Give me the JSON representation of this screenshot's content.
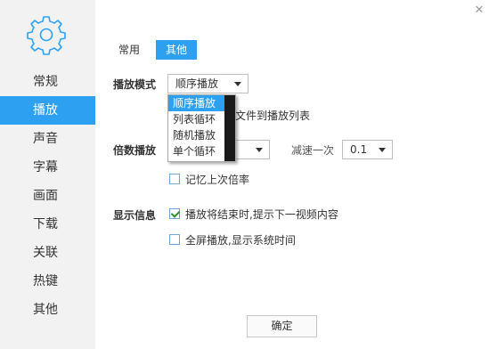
{
  "sidebar": {
    "icon": "gear-icon",
    "items": [
      {
        "label": "常规"
      },
      {
        "label": "播放"
      },
      {
        "label": "声音"
      },
      {
        "label": "字幕"
      },
      {
        "label": "画面"
      },
      {
        "label": "下载"
      },
      {
        "label": "关联"
      },
      {
        "label": "热键"
      },
      {
        "label": "其他"
      }
    ],
    "active_index": 1
  },
  "tabs": [
    {
      "label": "常用"
    },
    {
      "label": "其他"
    }
  ],
  "playback_mode": {
    "label": "播放模式",
    "selected": "顺序播放",
    "options": [
      "顺序播放",
      "列表循环",
      "随机播放",
      "单个循环"
    ],
    "partial_text": "文件到播放列表"
  },
  "speed": {
    "label": "倍数播放",
    "decrease_label": "减速一次",
    "decrease_value": "0.1",
    "remember_label": "记忆上次倍率",
    "remember_checked": false
  },
  "display_info": {
    "label": "显示信息",
    "options": [
      {
        "label": "播放将结束时,提示下一视频内容",
        "checked": true
      },
      {
        "label": "全屏播放,显示系统时间",
        "checked": false
      }
    ]
  },
  "ok_button": "确定",
  "close_symbol": "✕",
  "colors": {
    "accent": "#2ea0f2",
    "sidebar_bg": "#f2f2f2"
  }
}
